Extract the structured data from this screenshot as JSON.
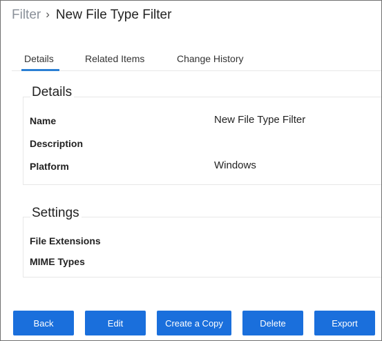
{
  "breadcrumb": {
    "parent": "Filter",
    "separator": "›",
    "title": "New File Type Filter"
  },
  "tabs": [
    {
      "label": "Details",
      "active": true
    },
    {
      "label": "Related Items",
      "active": false
    },
    {
      "label": "Change History",
      "active": false
    }
  ],
  "details": {
    "title": "Details",
    "fields": [
      {
        "label": "Name",
        "value": "New File Type Filter"
      },
      {
        "label": "Description",
        "value": ""
      },
      {
        "label": "Platform",
        "value": "Windows"
      }
    ]
  },
  "settings": {
    "title": "Settings",
    "fields": [
      {
        "label": "File Extensions",
        "value": ""
      },
      {
        "label": "MIME Types",
        "value": ""
      }
    ]
  },
  "actions": {
    "back": "Back",
    "edit": "Edit",
    "create_copy": "Create a Copy",
    "delete": "Delete",
    "export": "Export"
  },
  "colors": {
    "accent": "#2a7fd4",
    "button": "#1a6fdc",
    "border": "#e7e7e7",
    "breadcrumb_parent": "#8a9099"
  }
}
